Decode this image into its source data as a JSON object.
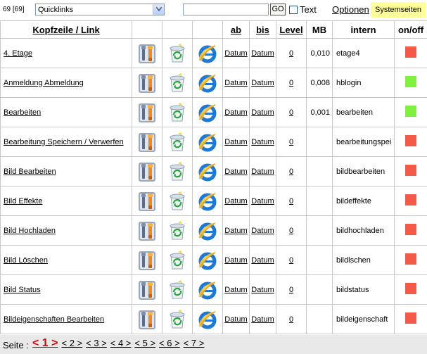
{
  "topbar": {
    "count": "69 [69]",
    "quicklinks_value": "Quicklinks",
    "search_value": "",
    "go_label": "GO",
    "text_label": "Text",
    "optionen_label": "Optionen",
    "system_label": "Systemseiten"
  },
  "table": {
    "headers": {
      "name": "Kopfzeile / Link",
      "ab": "ab",
      "bis": "bis",
      "level": "Level",
      "mb": "MB",
      "intern": "intern",
      "onoff": "on/off"
    },
    "rows": [
      {
        "name": "4. Etage",
        "ab": "Datum",
        "bis": "Datum",
        "level": "0",
        "mb": "0,010",
        "intern": "etage4",
        "status": "off"
      },
      {
        "name": "Anmeldung Abmeldung",
        "ab": "Datum",
        "bis": "Datum",
        "level": "0",
        "mb": "0,008",
        "intern": "hblogin",
        "status": "on"
      },
      {
        "name": "Bearbeiten",
        "ab": "Datum",
        "bis": "Datum",
        "level": "0",
        "mb": "0,001",
        "intern": "bearbeiten",
        "status": "on"
      },
      {
        "name": "Bearbeitung Speichern / Verwerfen",
        "ab": "Datum",
        "bis": "Datum",
        "level": "0",
        "mb": "",
        "intern": "bearbeitungspei",
        "status": "off"
      },
      {
        "name": "Bild Bearbeiten",
        "ab": "Datum",
        "bis": "Datum",
        "level": "0",
        "mb": "",
        "intern": "bildbearbeiten",
        "status": "off"
      },
      {
        "name": "Bild Effekte",
        "ab": "Datum",
        "bis": "Datum",
        "level": "0",
        "mb": "",
        "intern": "bildeffekte",
        "status": "off"
      },
      {
        "name": "Bild Hochladen",
        "ab": "Datum",
        "bis": "Datum",
        "level": "0",
        "mb": "",
        "intern": "bildhochladen",
        "status": "off"
      },
      {
        "name": "Bild Löschen",
        "ab": "Datum",
        "bis": "Datum",
        "level": "0",
        "mb": "",
        "intern": "bildlschen",
        "status": "off"
      },
      {
        "name": "Bild Status",
        "ab": "Datum",
        "bis": "Datum",
        "level": "0",
        "mb": "",
        "intern": "bildstatus",
        "status": "off"
      },
      {
        "name": "Bildeigenschaften Bearbeiten",
        "ab": "Datum",
        "bis": "Datum",
        "level": "0",
        "mb": "",
        "intern": "bildeigenschaft",
        "status": "off"
      }
    ],
    "icons": [
      "tools-icon",
      "recycle-icon",
      "internet-explorer-icon"
    ]
  },
  "colors": {
    "status_on": "#80f040",
    "status_off": "#f45a48",
    "system_bg": "#ffff99",
    "current_page": "#e00000"
  },
  "footer": {
    "seite_label": "Seite :",
    "current_page": "< 1 >",
    "pages": [
      "< 2 >",
      "< 3 >",
      "< 4 >",
      "< 5 >",
      "< 6 >",
      "< 7 >"
    ]
  }
}
